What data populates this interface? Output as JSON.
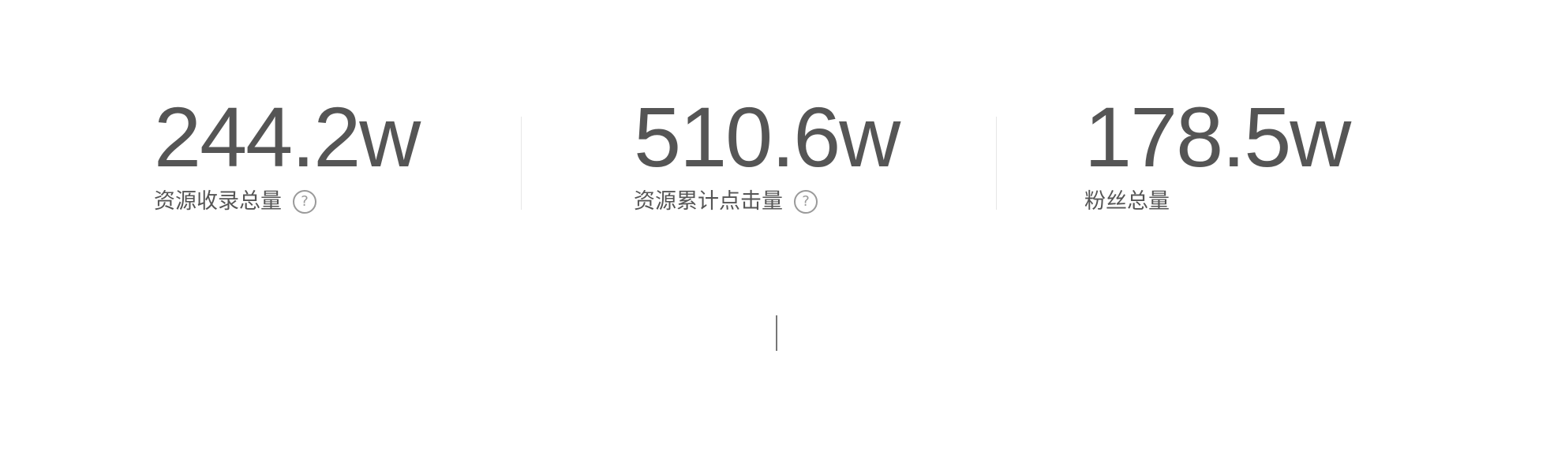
{
  "stats": [
    {
      "value": "244.2w",
      "label": "资源收录总量",
      "has_help": true,
      "help_glyph": "?"
    },
    {
      "value": "510.6w",
      "label": "资源累计点击量",
      "has_help": true,
      "help_glyph": "?"
    },
    {
      "value": "178.5w",
      "label": "粉丝总量",
      "has_help": false
    }
  ],
  "icons": {
    "help": "question-circle-icon"
  },
  "colors": {
    "text": "#555555",
    "help_icon": "#9a9a9a",
    "divider": "#e6e6e6",
    "background": "#ffffff"
  }
}
